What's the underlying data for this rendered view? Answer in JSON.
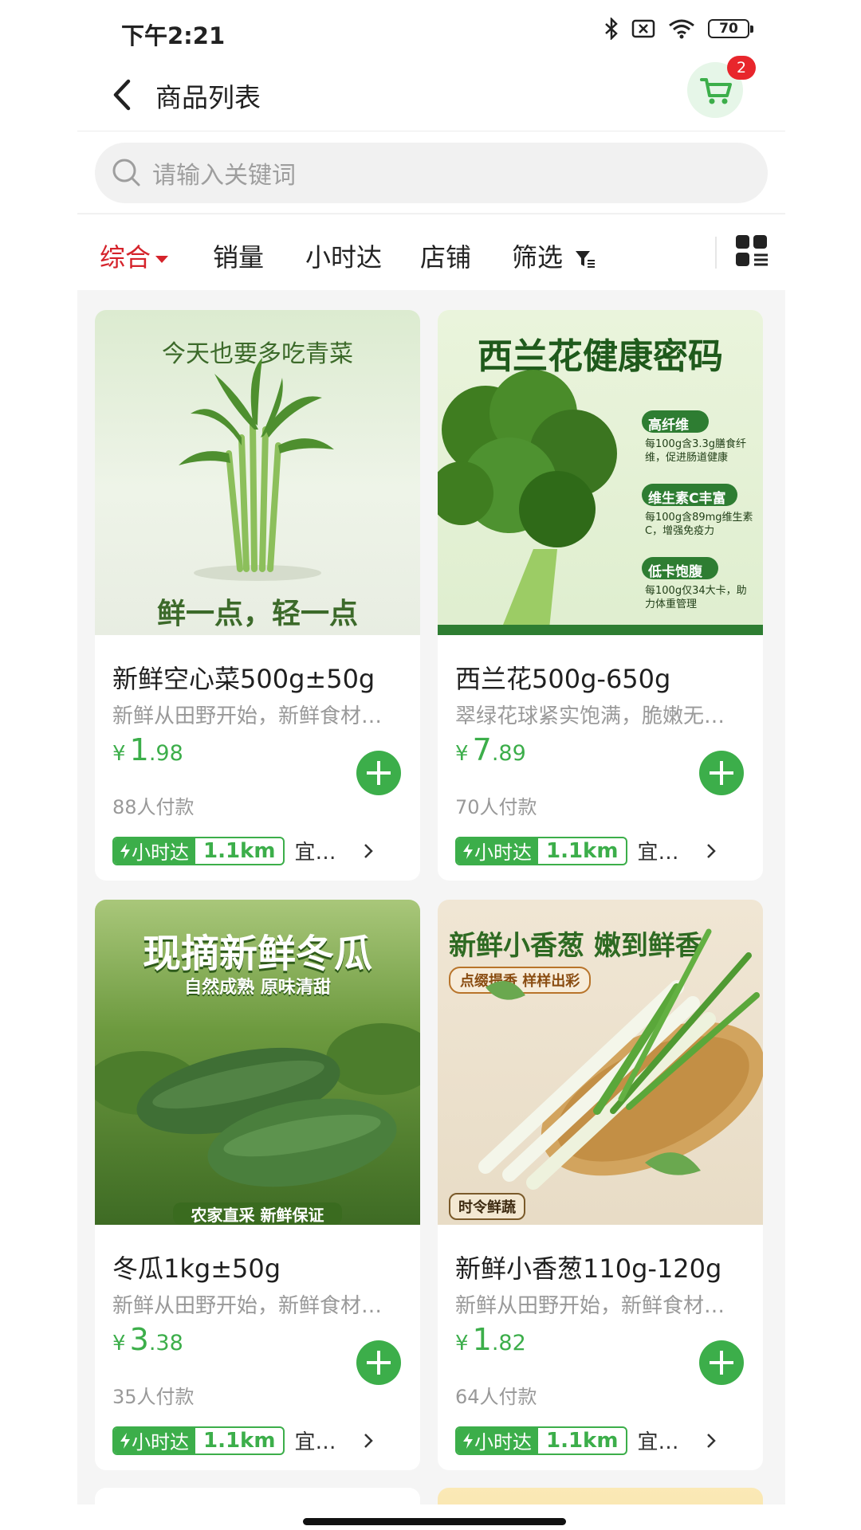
{
  "status_bar": {
    "time": "下午2:21",
    "battery": "70"
  },
  "header": {
    "title": "商品列表",
    "cart_count": "2"
  },
  "search": {
    "placeholder": "请输入关键词"
  },
  "sort_tabs": [
    "综合",
    "销量",
    "小时达",
    "店铺",
    "筛选"
  ],
  "colors": {
    "accent_green": "#3cae4a",
    "active_red": "#d5232b"
  },
  "products": [
    {
      "name": "新鲜空心菜500g±50g",
      "desc": "新鲜从田野开始，新鲜食材…",
      "price_int": "1",
      "price_dec": ".98",
      "currency": "¥",
      "sold": "88人付款",
      "tag_label": "小时达",
      "distance": "1.1km",
      "shop": "宜…",
      "image_top_text": "今天也要多吃青菜",
      "image_bottom_text": "鲜一点，轻一点"
    },
    {
      "name": "西兰花500g-650g",
      "desc": "翠绿花球紧实饱满，脆嫩无…",
      "price_int": "7",
      "price_dec": ".89",
      "currency": "¥",
      "sold": "70人付款",
      "tag_label": "小时达",
      "distance": "1.1km",
      "shop": "宜…",
      "image_top_text": "西兰花健康密码",
      "image_labels": [
        "高纤维",
        "每100g含3.3g膳食纤维，促进肠道健康",
        "维生素C丰富",
        "每100g含89mg维生素C，增强免疫力",
        "低卡饱腹",
        "每100g仅34大卡，助力体重管理"
      ]
    },
    {
      "name": "冬瓜1kg±50g",
      "desc": "新鲜从田野开始，新鲜食材…",
      "price_int": "3",
      "price_dec": ".38",
      "currency": "¥",
      "sold": "35人付款",
      "tag_label": "小时达",
      "distance": "1.1km",
      "shop": "宜…",
      "image_top_text": "现摘新鲜冬瓜",
      "image_sub_text": "自然成熟 原味清甜",
      "image_bottom_text": "农家直采 新鲜保证"
    },
    {
      "name": "新鲜小香葱110g-120g",
      "desc": "新鲜从田野开始，新鲜食材…",
      "price_int": "1",
      "price_dec": ".82",
      "currency": "¥",
      "sold": "64人付款",
      "tag_label": "小时达",
      "distance": "1.1km",
      "shop": "宜…",
      "image_top_text": "新鲜小香葱 嫩到鲜香",
      "image_sub_text": "点缀提香 样样出彩",
      "image_bottom_text": "时令鲜蔬"
    }
  ]
}
